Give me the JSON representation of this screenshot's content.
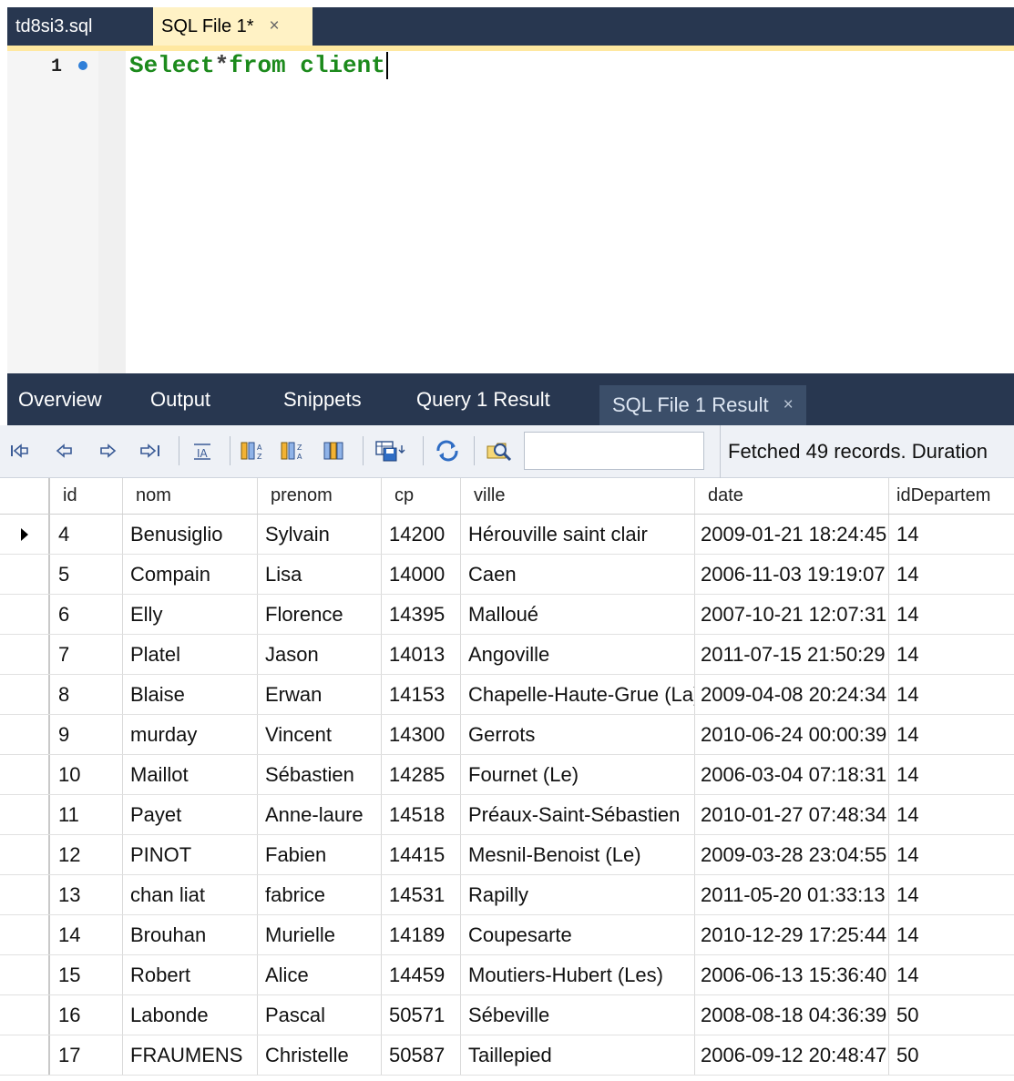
{
  "editor": {
    "tabs": [
      {
        "label": "td8si3.sql"
      },
      {
        "label": "SQL File 1*",
        "close": "×"
      }
    ],
    "line_number": "1",
    "code": {
      "keyword1": "Select",
      "star": "*",
      "rest": "from client"
    }
  },
  "result_panel": {
    "tabs": [
      {
        "label": "Overview"
      },
      {
        "label": "Output"
      },
      {
        "label": "Snippets"
      },
      {
        "label": "Query 1 Result"
      },
      {
        "label": "SQL File 1 Result",
        "close": "×"
      }
    ],
    "toolbar": {
      "status": "Fetched 49 records. Duration",
      "icons": [
        "first-record-icon",
        "previous-record-icon",
        "next-record-icon",
        "last-record-icon",
        "wrap-text-icon",
        "sort-asc-icon",
        "sort-desc-icon",
        "columns-icon",
        "export-icon",
        "refresh-icon",
        "search-icon"
      ],
      "search_value": ""
    }
  },
  "grid": {
    "columns": [
      "id",
      "nom",
      "prenom",
      "cp",
      "ville",
      "date",
      "idDepartem"
    ],
    "rows": [
      {
        "id": "4",
        "nom": "Benusiglio",
        "prenom": "Sylvain",
        "cp": "14200",
        "ville": "Hérouville saint clair",
        "date": "2009-01-21 18:24:45",
        "dep": "14"
      },
      {
        "id": "5",
        "nom": "Compain",
        "prenom": "Lisa",
        "cp": "14000",
        "ville": "Caen",
        "date": "2006-11-03 19:19:07",
        "dep": "14"
      },
      {
        "id": "6",
        "nom": "Elly",
        "prenom": "Florence",
        "cp": "14395",
        "ville": "Malloué",
        "date": "2007-10-21 12:07:31",
        "dep": "14"
      },
      {
        "id": "7",
        "nom": "Platel",
        "prenom": "Jason",
        "cp": "14013",
        "ville": "Angoville",
        "date": "2011-07-15 21:50:29",
        "dep": "14"
      },
      {
        "id": "8",
        "nom": "Blaise",
        "prenom": "Erwan",
        "cp": "14153",
        "ville": "Chapelle-Haute-Grue (La)",
        "date": "2009-04-08 20:24:34",
        "dep": "14"
      },
      {
        "id": "9",
        "nom": "murday",
        "prenom": "Vincent",
        "cp": "14300",
        "ville": "Gerrots",
        "date": "2010-06-24 00:00:39",
        "dep": "14"
      },
      {
        "id": "10",
        "nom": "Maillot",
        "prenom": "Sébastien",
        "cp": "14285",
        "ville": "Fournet (Le)",
        "date": "2006-03-04 07:18:31",
        "dep": "14"
      },
      {
        "id": "11",
        "nom": "Payet",
        "prenom": "Anne-laure",
        "cp": "14518",
        "ville": "Préaux-Saint-Sébastien",
        "date": "2010-01-27 07:48:34",
        "dep": "14"
      },
      {
        "id": "12",
        "nom": "PINOT",
        "prenom": "Fabien",
        "cp": "14415",
        "ville": "Mesnil-Benoist (Le)",
        "date": "2009-03-28 23:04:55",
        "dep": "14"
      },
      {
        "id": "13",
        "nom": "chan liat",
        "prenom": "fabrice",
        "cp": "14531",
        "ville": "Rapilly",
        "date": "2011-05-20 01:33:13",
        "dep": "14"
      },
      {
        "id": "14",
        "nom": "Brouhan",
        "prenom": "Murielle",
        "cp": "14189",
        "ville": "Coupesarte",
        "date": "2010-12-29 17:25:44",
        "dep": "14"
      },
      {
        "id": "15",
        "nom": "Robert",
        "prenom": "Alice",
        "cp": "14459",
        "ville": "Moutiers-Hubert (Les)",
        "date": "2006-06-13 15:36:40",
        "dep": "14"
      },
      {
        "id": "16",
        "nom": "Labonde",
        "prenom": "Pascal",
        "cp": "50571",
        "ville": "Sébeville",
        "date": "2008-08-18 04:36:39",
        "dep": "50"
      },
      {
        "id": "17",
        "nom": "FRAUMENS",
        "prenom": "Christelle",
        "cp": "50587",
        "ville": "Taillepied",
        "date": "2006-09-12 20:48:47",
        "dep": "50"
      }
    ]
  }
}
